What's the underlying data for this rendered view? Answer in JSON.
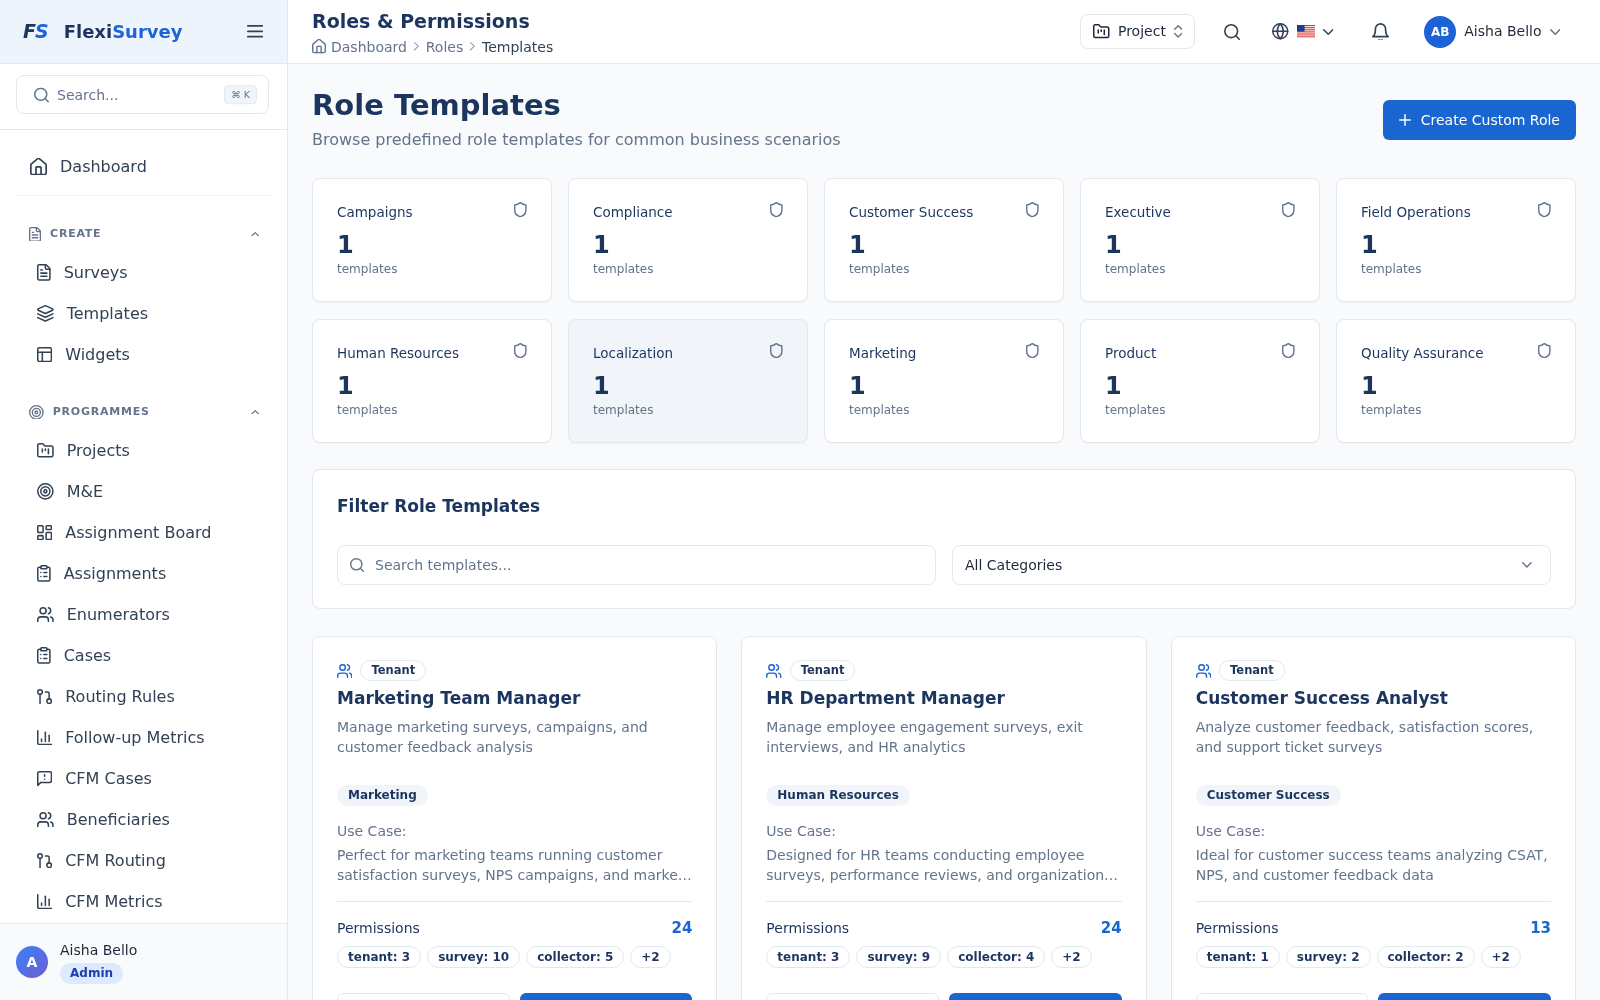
{
  "sidebar": {
    "brand": {
      "mark": [
        {
          "text": "F",
          "accent": false
        },
        {
          "text": "S",
          "accent": true
        }
      ],
      "name": [
        {
          "text": "Flexi",
          "accent": false
        },
        {
          "text": "Survey",
          "accent": true
        }
      ]
    },
    "search": {
      "placeholder": "Search...",
      "shortcut": "⌘ K"
    },
    "top_items": [
      {
        "label": "Dashboard",
        "selected": false
      }
    ],
    "sections": [
      {
        "title": "CREATE",
        "expanded": true,
        "items": [
          {
            "label": "Surveys",
            "selected": false
          },
          {
            "label": "Templates",
            "selected": false
          },
          {
            "label": "Widgets",
            "selected": false
          }
        ]
      },
      {
        "title": "PROGRAMMES",
        "expanded": true,
        "items": [
          {
            "label": "Projects",
            "selected": false
          },
          {
            "label": "M&E",
            "selected": false
          },
          {
            "label": "Assignment Board",
            "selected": false
          },
          {
            "label": "Assignments",
            "selected": false
          },
          {
            "label": "Enumerators",
            "selected": false
          },
          {
            "label": "Cases",
            "selected": false
          },
          {
            "label": "Routing Rules",
            "selected": false
          },
          {
            "label": "Follow-up Metrics",
            "selected": false
          },
          {
            "label": "CFM Cases",
            "selected": false
          },
          {
            "label": "Beneficiaries",
            "selected": false
          },
          {
            "label": "CFM Routing",
            "selected": false
          },
          {
            "label": "CFM Metrics",
            "selected": false
          }
        ]
      }
    ],
    "user": {
      "initial": "A",
      "name": "Aisha Bello",
      "role": "Admin"
    }
  },
  "topbar": {
    "title": "Roles & Permissions",
    "breadcrumb": [
      {
        "label": "Dashboard",
        "current": false
      },
      {
        "label": "Roles",
        "current": false
      },
      {
        "label": "Templates",
        "current": true
      }
    ],
    "project_button": "Project",
    "user": {
      "initials": "AB",
      "name": "Aisha Bello"
    }
  },
  "page_header": {
    "title": "Role Templates",
    "subtitle": "Browse predefined role templates for common business scenarios",
    "create_button": "Create Custom Role"
  },
  "categories": [
    {
      "name": "Campaigns",
      "count": "1",
      "unit": "templates",
      "hovered": false
    },
    {
      "name": "Compliance",
      "count": "1",
      "unit": "templates",
      "hovered": false
    },
    {
      "name": "Customer Success",
      "count": "1",
      "unit": "templates",
      "hovered": false
    },
    {
      "name": "Executive",
      "count": "1",
      "unit": "templates",
      "hovered": false
    },
    {
      "name": "Field Operations",
      "count": "1",
      "unit": "templates",
      "hovered": false
    },
    {
      "name": "Human Resources",
      "count": "1",
      "unit": "templates",
      "hovered": false
    },
    {
      "name": "Localization",
      "count": "1",
      "unit": "templates",
      "hovered": true
    },
    {
      "name": "Marketing",
      "count": "1",
      "unit": "templates",
      "hovered": false
    },
    {
      "name": "Product",
      "count": "1",
      "unit": "templates",
      "hovered": false
    },
    {
      "name": "Quality Assurance",
      "count": "1",
      "unit": "templates",
      "hovered": false
    }
  ],
  "filter": {
    "title": "Filter Role Templates",
    "search_placeholder": "Search templates...",
    "category": "All Categories"
  },
  "templates": [
    {
      "scope": "Tenant",
      "name": "Marketing Team Manager",
      "description": "Manage marketing surveys, campaigns, and customer feedback analysis",
      "category": "Marketing",
      "use_case_label": "Use Case:",
      "use_case": "Perfect for marketing teams running customer satisfaction surveys, NPS campaigns, and marke…",
      "permissions_label": "Permissions",
      "permission_count": "24",
      "permission_tags": [
        "tenant: 3",
        "survey: 10",
        "collector: 5",
        "+2"
      ]
    },
    {
      "scope": "Tenant",
      "name": "HR Department Manager",
      "description": "Manage employee engagement surveys, exit interviews, and HR analytics",
      "category": "Human Resources",
      "use_case_label": "Use Case:",
      "use_case": "Designed for HR teams conducting employee surveys, performance reviews, and organization…",
      "permissions_label": "Permissions",
      "permission_count": "24",
      "permission_tags": [
        "tenant: 3",
        "survey: 9",
        "collector: 4",
        "+2"
      ]
    },
    {
      "scope": "Tenant",
      "name": "Customer Success Analyst",
      "description": "Analyze customer feedback, satisfaction scores, and support ticket surveys",
      "category": "Customer Success",
      "use_case_label": "Use Case:",
      "use_case": "Ideal for customer success teams analyzing CSAT, NPS, and customer feedback data",
      "permissions_label": "Permissions",
      "permission_count": "13",
      "permission_tags": [
        "tenant: 1",
        "survey: 2",
        "collector: 2",
        "+2"
      ]
    }
  ]
}
